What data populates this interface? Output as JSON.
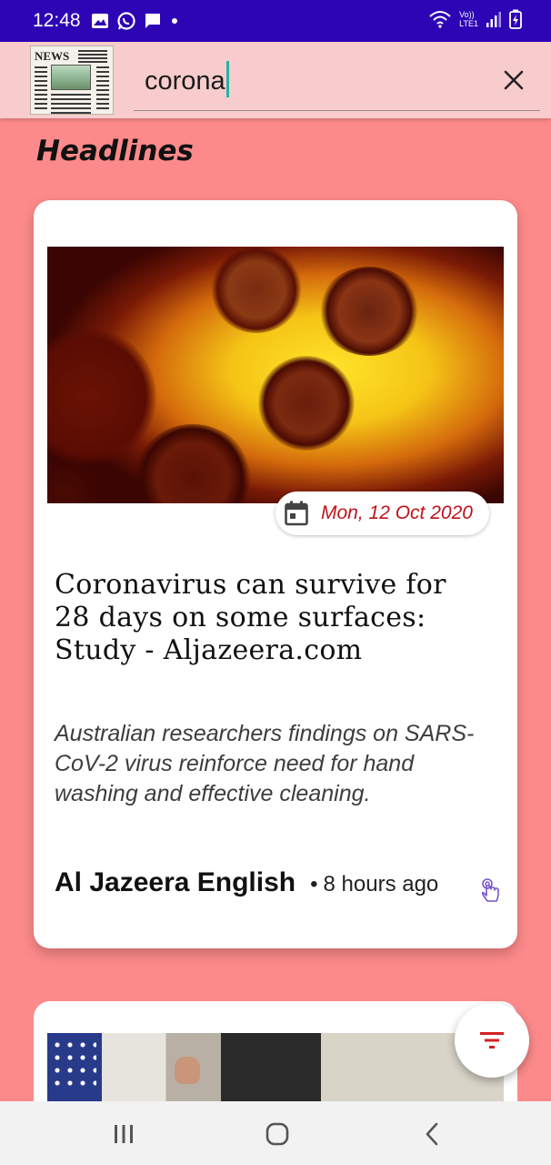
{
  "status_bar": {
    "time": "12:48",
    "notification_icons": [
      "image-icon",
      "whatsapp-icon",
      "message-icon",
      "dot-icon"
    ],
    "network_label_top": "Vo))",
    "network_label_bottom": "LTE1",
    "battery_state": "charging"
  },
  "app_bar": {
    "logo_masthead": "NEWS",
    "search_value": "corona",
    "clear_icon": "close-icon"
  },
  "section_title": "Headlines",
  "article": {
    "date": "Mon, 12 Oct 2020",
    "title": "Coronavirus can survive for 28 days on some surfaces: Study - Aljazeera.com",
    "description": "Australian researchers findings on SARS-CoV-2 virus reinforce need for hand washing and effective cleaning.",
    "source": "Al Jazeera English",
    "separator": "•",
    "published": "8 hours ago"
  },
  "fab_icon": "filter-icon",
  "colors": {
    "status_bar": "#2d05b5",
    "app_bar": "#f8cccc",
    "background": "#fd8a8a",
    "date_text": "#c0121a",
    "filter_icon": "#d32020"
  }
}
